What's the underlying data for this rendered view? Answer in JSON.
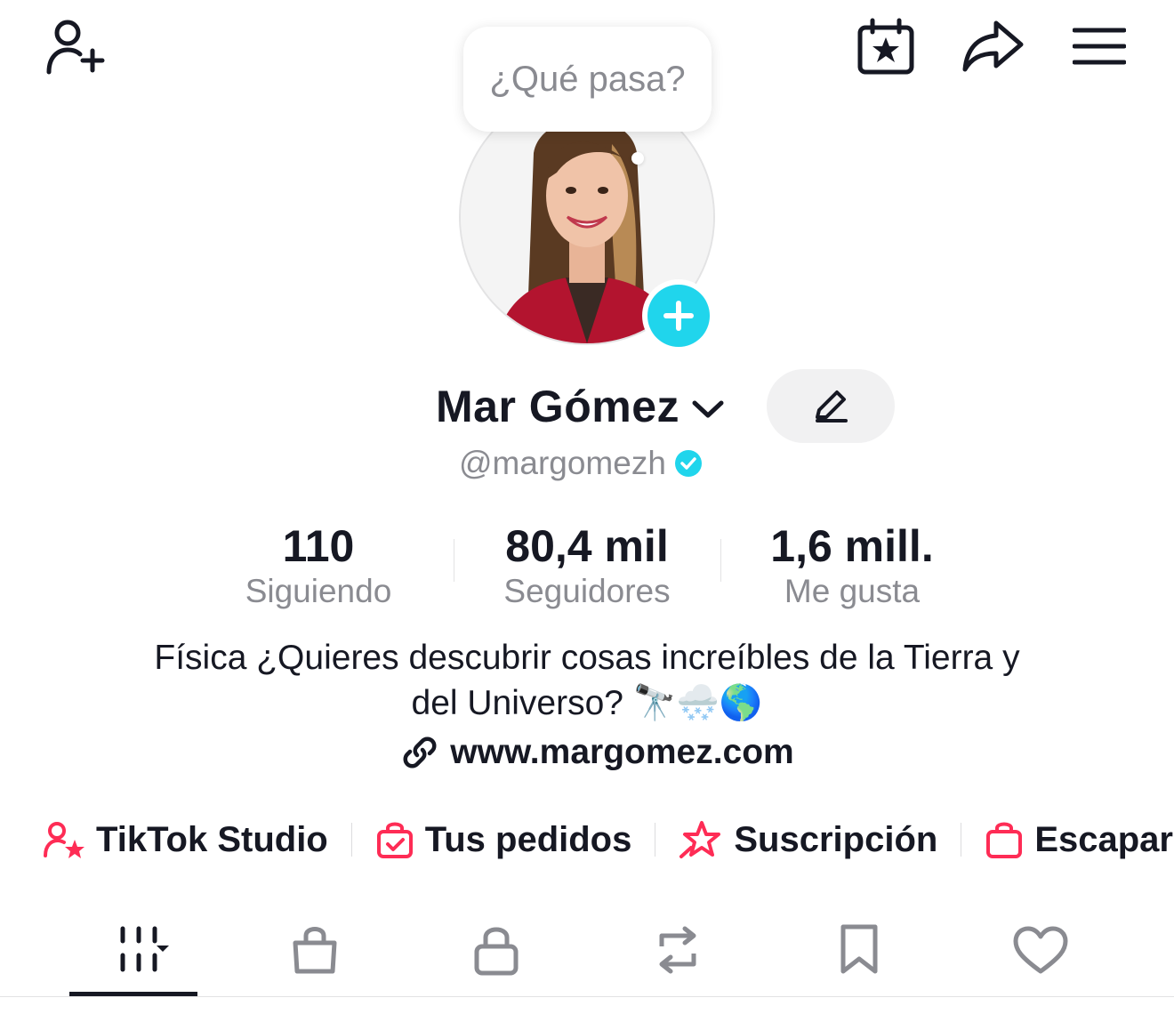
{
  "header": {
    "add_friend_icon": "person-add-icon",
    "calendar_icon": "calendar-star-icon",
    "share_icon": "share-arrow-icon",
    "menu_icon": "hamburger-menu-icon"
  },
  "tooltip": {
    "text": "¿Qué pasa?"
  },
  "profile": {
    "name": "Mar Gómez",
    "username": "@margomezh",
    "verified": true
  },
  "stats": [
    {
      "value": "110",
      "label": "Siguiendo"
    },
    {
      "value": "80,4 mil",
      "label": "Seguidores"
    },
    {
      "value": "1,6 mill.",
      "label": "Me gusta"
    }
  ],
  "bio": {
    "line1": "Física  ¿Quieres descubrir cosas increíbles de la Tierra y",
    "line2": "del Universo? 🔭🌨️🌎",
    "link": "www.margomez.com"
  },
  "shortcuts": [
    {
      "label": "TikTok Studio",
      "icon": "person-star-icon"
    },
    {
      "label": "Tus pedidos",
      "icon": "shopping-bag-check-icon"
    },
    {
      "label": "Suscripción",
      "icon": "shooting-star-icon"
    },
    {
      "label": "Escapar",
      "icon": "shopping-bag-icon"
    }
  ],
  "tabs": [
    {
      "icon": "video-grid-icon",
      "active": true
    },
    {
      "icon": "shop-bag-icon"
    },
    {
      "icon": "lock-icon"
    },
    {
      "icon": "repost-icon"
    },
    {
      "icon": "bookmark-icon"
    },
    {
      "icon": "heart-icon"
    }
  ],
  "colors": {
    "accent": "#20d5ec",
    "pink": "#fe2c55",
    "text": "#161823",
    "muted": "#8a8b91"
  }
}
